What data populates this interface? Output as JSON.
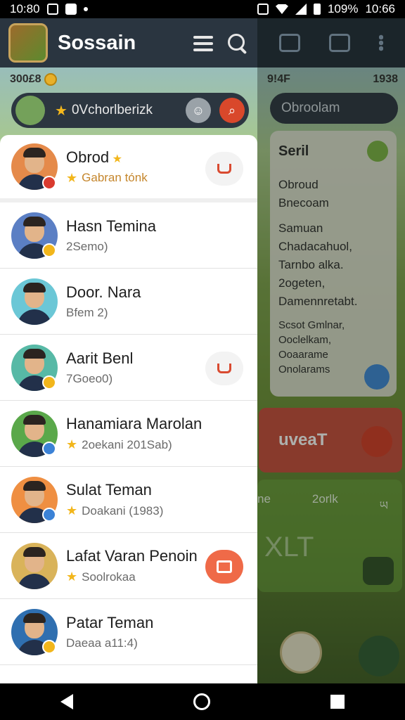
{
  "status_bar": {
    "time_left": "10:80",
    "battery": "109%",
    "time_right": "10:66"
  },
  "header": {
    "app_title": "Sossain"
  },
  "profile": {
    "coins": "300£8",
    "name": "0Vchorlberizk"
  },
  "friends": [
    {
      "name": "Obrod",
      "status": "Gabran tónk",
      "starred": true,
      "title_star": true,
      "has_action": true,
      "badge_color": "#d93a2e"
    },
    {
      "name": "Hasn Temina",
      "status": "2Semo)",
      "starred": false,
      "has_action": false,
      "badge_color": "#f2b61b"
    },
    {
      "name": "Door. Nara",
      "status": "Bfem 2)",
      "starred": false,
      "has_action": false,
      "badge_color": ""
    },
    {
      "name": "Aarit Benl",
      "status": "7Goeo0)",
      "starred": false,
      "has_action": true,
      "badge_color": "#f2b61b"
    },
    {
      "name": "Hanamiara Marolan",
      "status": "2oekani 201Sab)",
      "starred": true,
      "has_action": false,
      "badge_color": "#3b82d6"
    },
    {
      "name": "Sulat Teman",
      "status": "Doakani (1983)",
      "starred": true,
      "has_action": false,
      "badge_color": "#3b82d6"
    },
    {
      "name": "Lafat Varan Penoin",
      "status": "Soolrokaa",
      "starred": true,
      "has_action": true,
      "action_style": "orange",
      "badge_color": ""
    },
    {
      "name": "Patar Teman",
      "status": "Daeaa a11:4)",
      "starred": false,
      "has_action": false,
      "badge_color": "#f2b61b"
    }
  ],
  "right_panel": {
    "stat_left": "9!4F",
    "stat_right": "1938",
    "search_text": "Obroolam",
    "card": {
      "title": "Seril",
      "lines": [
        "Obroud",
        "Bnecoam"
      ],
      "block": [
        "Samuan",
        "Chadacahuol,",
        "Tarnbo alka.",
        "2ogeten,",
        "Damennretabt."
      ],
      "small": [
        "Scsot Gmlnar,",
        "Ooclelkam,",
        "Ooaarame",
        "Onolarams"
      ]
    },
    "banner_text": "uveaT",
    "panel_left": "ne",
    "panel_mid": "2orlk",
    "panel_right": "ཡ",
    "panel_big": "XLT"
  }
}
